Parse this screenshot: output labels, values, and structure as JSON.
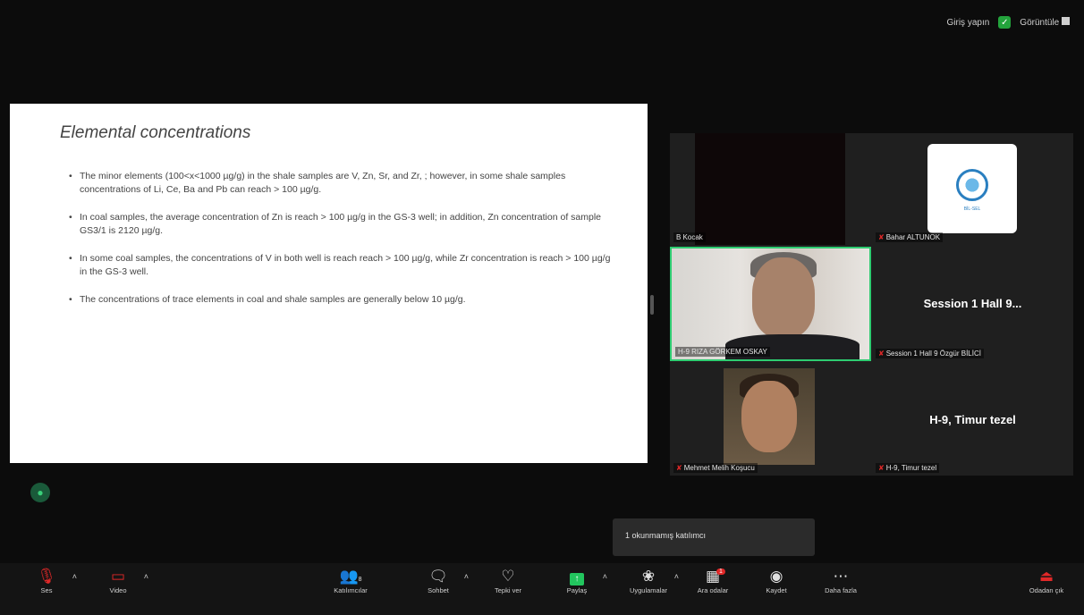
{
  "top_status": {
    "signin_label": "Giriş yapın",
    "view_label": "Görüntüle"
  },
  "slide": {
    "title": "Elemental concentrations",
    "bullets": [
      "The minor elements (100<x<1000  µg/g) in the shale samples are V, Zn, Sr, and Zr, ; however, in some shale samples concentrations of Li, Ce, Ba and Pb can reach > 100 µg/g.",
      "In coal samples, the average concentration of Zn is reach > 100 µg/g in the GS-3 well; in addition, Zn concentration of sample GS3/1 is 2120 µg/g.",
      "In some coal samples, the concentrations of V in both well is reach reach > 100 µg/g, while Zr concentration is reach > 100 µg/g in the GS-3 well.",
      "The concentrations of trace elements in coal and shale samples are generally below 10  µg/g."
    ]
  },
  "participants": [
    {
      "name": "B Kocak"
    },
    {
      "name": "Bahar ALTUNOK",
      "logo_text": "BİL-SEL"
    },
    {
      "name": "H-9 RIZA GÖRKEM OSKAY"
    },
    {
      "name": "Session 1 Hall 9 Özgür BİLİCİ",
      "display": "Session 1 Hall 9..."
    },
    {
      "name": "Mehmet Melih Koşucu"
    },
    {
      "name": "H-9, Timur tezel",
      "display": "H-9, Timur tezel"
    }
  ],
  "tooltip": "1 okunmamış katılımcı",
  "toolbar": {
    "audio": "Ses",
    "video": "Video",
    "participants": "Katılımcılar",
    "participants_count": "8",
    "chat": "Sohbet",
    "reactions": "Tepki ver",
    "share": "Paylaş",
    "apps": "Uygulamalar",
    "breakout": "Ara odalar",
    "breakout_badge": "1",
    "record": "Kaydet",
    "more": "Daha fazla",
    "leave": "Odadan çık"
  }
}
